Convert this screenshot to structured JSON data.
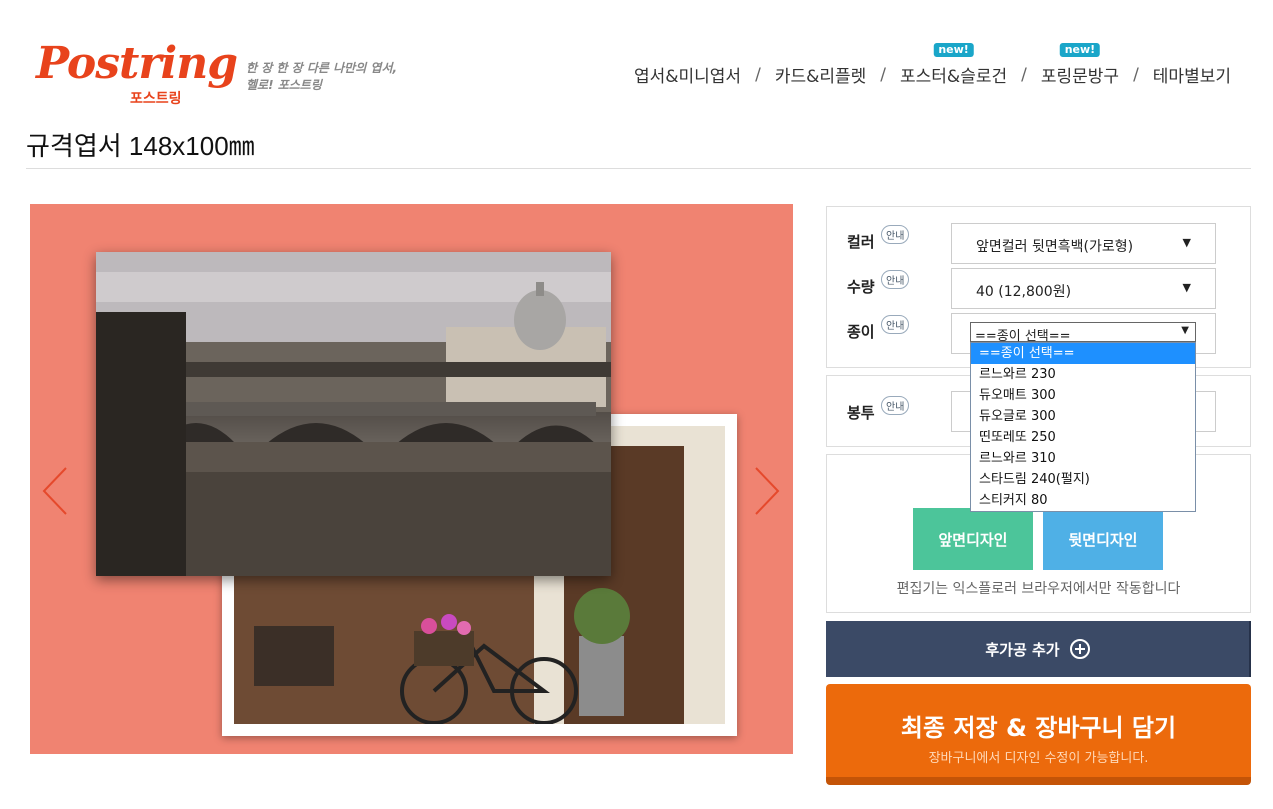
{
  "header": {
    "logo_text": "Postring",
    "logo_sub": "포스트링",
    "tagline_line1": "한 장 한 장 다른 나만의 엽서,",
    "tagline_line2": "헬로! 포스트링",
    "nav": [
      {
        "label": "엽서&미니엽서",
        "badge": ""
      },
      {
        "label": "카드&리플렛",
        "badge": ""
      },
      {
        "label": "포스터&슬로건",
        "badge": "new!"
      },
      {
        "label": "포링문방구",
        "badge": "new!"
      },
      {
        "label": "테마별보기",
        "badge": ""
      }
    ],
    "nav_separator": "/"
  },
  "page": {
    "title": "규격엽서 148x100㎜"
  },
  "options": {
    "info_label": "안내",
    "color": {
      "label": "컬러",
      "value": "앞면컬러 뒷면흑백(가로형)"
    },
    "quantity": {
      "label": "수량",
      "value": "40 (12,800원)"
    },
    "paper": {
      "label": "종이",
      "value": "==종이 선택==",
      "options": [
        "==종이 선택==",
        "르느와르 230",
        "듀오매트 300",
        "듀오글로 300",
        "띤또레또 250",
        "르느와르 310",
        "스타드림 240(펄지)",
        "스티커지 80"
      ]
    },
    "envelope": {
      "label": "봉투"
    },
    "caret": "▼"
  },
  "design": {
    "front_label": "앞면디자인",
    "back_label": "뒷면디자인",
    "editor_note": "편집기는 익스플로러 브라우저에서만 작동합니다"
  },
  "actions": {
    "addon_label": "후가공 추가",
    "cart_label": "최종 저장 & 장바구니 담기",
    "cart_sub": "장바구니에서 디자인 수정이 가능합니다."
  },
  "colors": {
    "accent": "#ec6a0c",
    "stage_bg": "#f08371",
    "front_btn": "#4cc59a",
    "back_btn": "#4fb0e6",
    "addon_bg": "#3b4a66",
    "brand": "#e8431c"
  }
}
